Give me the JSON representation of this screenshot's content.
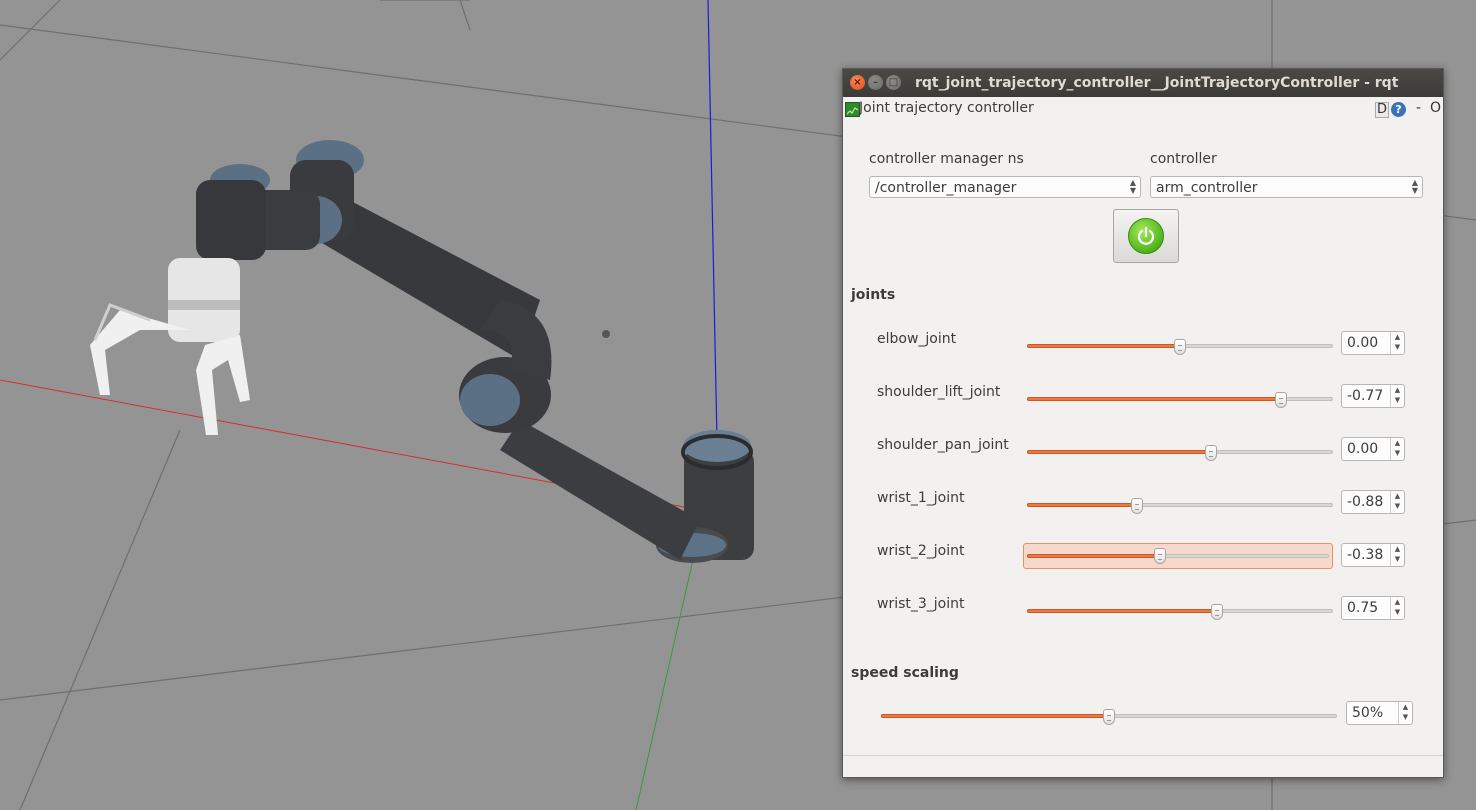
{
  "window": {
    "title": "rqt_joint_trajectory_controller__JointTrajectoryController - rqt",
    "close_glyph": "×",
    "minimize_glyph": "–",
    "maximize_glyph": "□"
  },
  "plugin": {
    "title": "Joint trajectory controller",
    "help_d": "D",
    "help_q": "?",
    "dock_minimize": "-",
    "dock_close": "O"
  },
  "controller_manager": {
    "label": "controller manager ns",
    "value": "/controller_manager"
  },
  "controller": {
    "label": "controller",
    "value": "arm_controller"
  },
  "joints": {
    "title": "joints",
    "items": [
      {
        "name": "elbow_joint",
        "value": "0.00",
        "fraction": 0.5
      },
      {
        "name": "shoulder_lift_joint",
        "value": "-0.77",
        "fraction": 0.83
      },
      {
        "name": "shoulder_pan_joint",
        "value": "0.00",
        "fraction": 0.6
      },
      {
        "name": "wrist_1_joint",
        "value": "-0.88",
        "fraction": 0.36
      },
      {
        "name": "wrist_2_joint",
        "value": "-0.38",
        "fraction": 0.44
      },
      {
        "name": "wrist_3_joint",
        "value": "0.75",
        "fraction": 0.62
      }
    ]
  },
  "speed_scaling": {
    "title": "speed scaling",
    "value": "50%",
    "fraction": 0.5
  },
  "colors": {
    "accent": "#ef7842",
    "power": "#4eb51c",
    "titlebar": "#3c3b37"
  }
}
